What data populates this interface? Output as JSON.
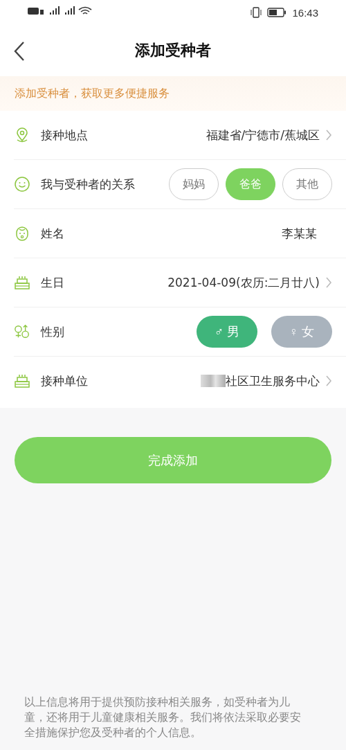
{
  "status_bar": {
    "time": "16:43"
  },
  "header": {
    "title": "添加受种者"
  },
  "banner": {
    "text": "添加受种者，获取更多便捷服务"
  },
  "rows": [
    {
      "kind": "picker",
      "label": "接种地点",
      "value": "福建省/宁德市/蕉城区"
    },
    {
      "kind": "choice",
      "label": "我与受种者的关系",
      "options": [
        {
          "label": "妈妈",
          "selected": false
        },
        {
          "label": "爸爸",
          "selected": true
        },
        {
          "label": "其他",
          "selected": false
        }
      ]
    },
    {
      "kind": "text",
      "label": "姓名",
      "value": "李某某"
    },
    {
      "kind": "picker",
      "label": "生日",
      "value": "2021-04-09(农历:二月廿八)"
    },
    {
      "kind": "gender",
      "label": "性别",
      "options": [
        {
          "symbol": "♂",
          "label": "男",
          "selected": true
        },
        {
          "symbol": "♀",
          "label": "女",
          "selected": false
        }
      ]
    },
    {
      "kind": "picker",
      "label": "接种单位",
      "value": "社区卫生服务中心",
      "redacted": true
    }
  ],
  "submit": {
    "label": "完成添加"
  },
  "footer": {
    "text": "以上信息将用于提供预防接种相关服务，如受种者为儿童，还将用于儿童健康相关服务。我们将依法采取必要安全措施保护您及受种者的个人信息。"
  }
}
